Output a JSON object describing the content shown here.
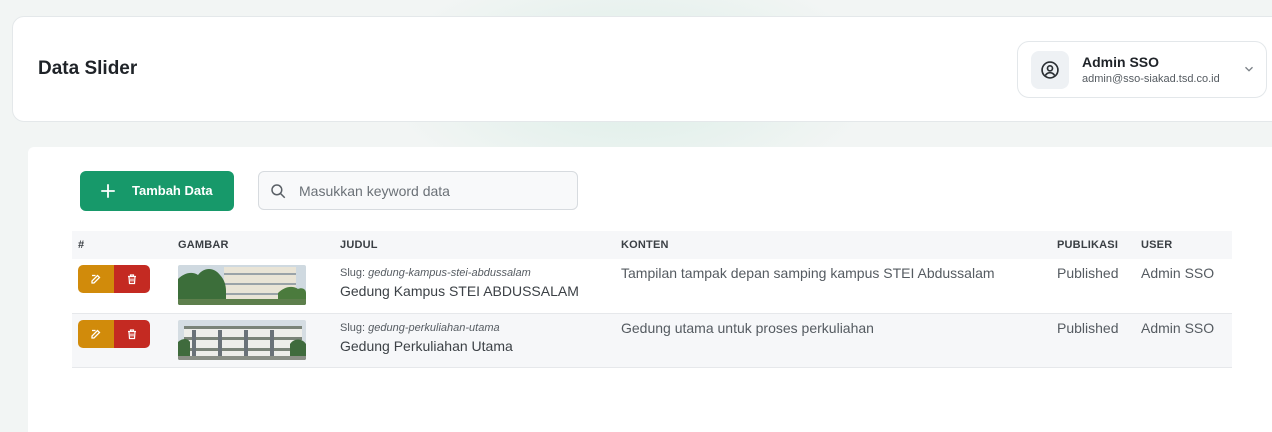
{
  "header": {
    "title": "Data Slider",
    "user": {
      "name": "Admin SSO",
      "email": "admin@sso-siakad.tsd.co.id"
    }
  },
  "toolbar": {
    "add_label": "Tambah Data",
    "search_placeholder": "Masukkan keyword data"
  },
  "table": {
    "columns": [
      "#",
      "GAMBAR",
      "JUDUL",
      "KONTEN",
      "PUBLIKASI",
      "USER"
    ],
    "slug_prefix": "Slug:",
    "rows": [
      {
        "slug": "gedung-kampus-stei-abdussalam",
        "judul": "Gedung Kampus STEI ABDUSSALAM",
        "konten": "Tampilan tampak depan samping kampus STEI Abdussalam",
        "publikasi": "Published",
        "user": "Admin SSO"
      },
      {
        "slug": "gedung-perkuliahan-utama",
        "judul": "Gedung Perkuliahan Utama",
        "konten": "Gedung utama untuk proses perkuliahan",
        "publikasi": "Published",
        "user": "Admin SSO"
      }
    ]
  },
  "colors": {
    "primary": "#17996a",
    "edit": "#d18b0b",
    "delete": "#c42a22"
  }
}
